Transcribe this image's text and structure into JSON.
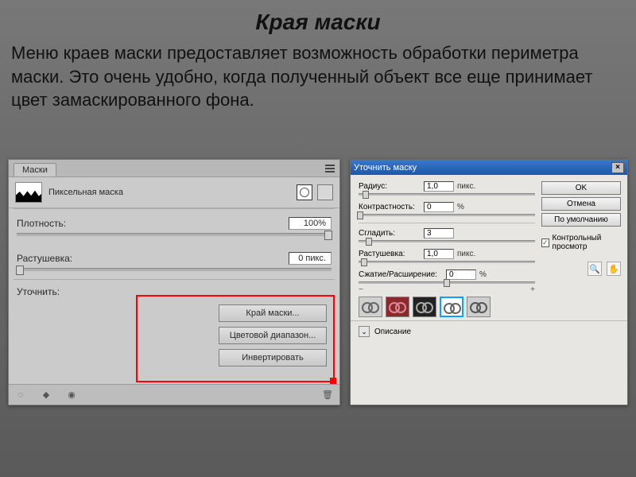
{
  "header": {
    "title": "Края маски",
    "description": "Меню краев маски предоставляет возможность обработки периметра маски. Это очень удобно, когда полученный объект все еще принимает цвет замаскированного фона."
  },
  "masks_panel": {
    "tab": "Маски",
    "mask_type": "Пиксельная маска",
    "density_label": "Плотность:",
    "density_value": "100%",
    "feather_label": "Растушевка:",
    "feather_value": "0 пикс.",
    "refine_label": "Уточнить:",
    "buttons": {
      "edge": "Край маски...",
      "color_range": "Цветовой диапазон...",
      "invert": "Инвертировать"
    }
  },
  "refine_dialog": {
    "title": "Уточнить маску",
    "ok": "OK",
    "cancel": "Отмена",
    "default": "По умолчанию",
    "preview_check": "Контрольный просмотр",
    "radius_label": "Радиус:",
    "radius_value": "1,0",
    "radius_unit": "пикс.",
    "contrast_label": "Контрастность:",
    "contrast_value": "0",
    "contrast_unit": "%",
    "smooth_label": "Сгладить:",
    "smooth_value": "3",
    "feather_label": "Растушевка:",
    "feather_value": "1,0",
    "feather_unit": "пикс.",
    "shrink_label": "Сжатие/Расширение:",
    "shrink_value": "0",
    "shrink_unit": "%",
    "description_label": "Описание"
  }
}
